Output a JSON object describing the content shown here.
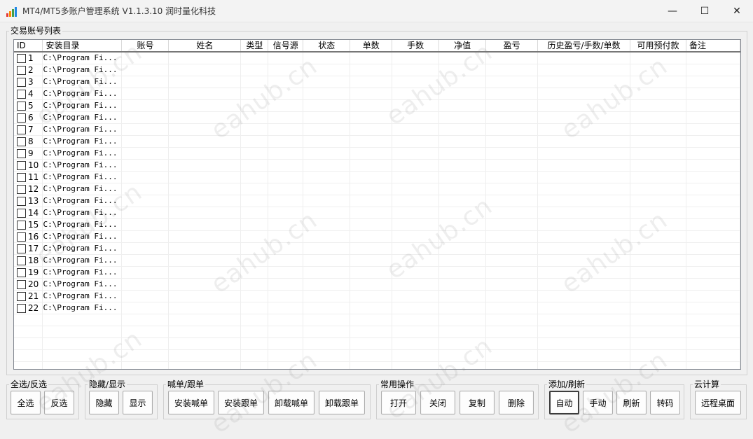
{
  "window": {
    "title": "MT4/MT5多账户管理系统 V1.1.3.10 润时量化科技",
    "minimize_glyph": "—",
    "maximize_glyph": "☐",
    "close_glyph": "✕"
  },
  "accounts_group": {
    "label": "交易账号列表",
    "columns": [
      "ID",
      "安装目录",
      "账号",
      "姓名",
      "类型",
      "信号源",
      "状态",
      "单数",
      "手数",
      "净值",
      "盈亏",
      "历史盈亏/手数/单数",
      "可用预付款",
      "备注"
    ],
    "rows": [
      {
        "id": "1",
        "path": "C:\\Program Fi..."
      },
      {
        "id": "2",
        "path": "C:\\Program Fi..."
      },
      {
        "id": "3",
        "path": "C:\\Program Fi..."
      },
      {
        "id": "4",
        "path": "C:\\Program Fi..."
      },
      {
        "id": "5",
        "path": "C:\\Program Fi..."
      },
      {
        "id": "6",
        "path": "C:\\Program Fi..."
      },
      {
        "id": "7",
        "path": "C:\\Program Fi..."
      },
      {
        "id": "8",
        "path": "C:\\Program Fi..."
      },
      {
        "id": "9",
        "path": "C:\\Program Fi..."
      },
      {
        "id": "10",
        "path": "C:\\Program Fi..."
      },
      {
        "id": "11",
        "path": "C:\\Program Fi..."
      },
      {
        "id": "12",
        "path": "C:\\Program Fi..."
      },
      {
        "id": "13",
        "path": "C:\\Program Fi..."
      },
      {
        "id": "14",
        "path": "C:\\Program Fi..."
      },
      {
        "id": "15",
        "path": "C:\\Program Fi..."
      },
      {
        "id": "16",
        "path": "C:\\Program Fi..."
      },
      {
        "id": "17",
        "path": "C:\\Program Fi..."
      },
      {
        "id": "18",
        "path": "C:\\Program Fi..."
      },
      {
        "id": "19",
        "path": "C:\\Program Fi..."
      },
      {
        "id": "20",
        "path": "C:\\Program Fi..."
      },
      {
        "id": "21",
        "path": "C:\\Program Fi..."
      },
      {
        "id": "22",
        "path": "C:\\Program Fi..."
      }
    ]
  },
  "groups": {
    "select": {
      "label": "全选/反选",
      "buttons": [
        "全选",
        "反选"
      ]
    },
    "hide_show": {
      "label": "隐藏/显示",
      "buttons": [
        "隐藏",
        "显示"
      ]
    },
    "call_follow": {
      "label": "喊单/跟单",
      "buttons": [
        "安装喊单",
        "安装跟单",
        "卸载喊单",
        "卸载跟单"
      ]
    },
    "common_ops": {
      "label": "常用操作",
      "buttons": [
        "打开",
        "关闭",
        "复制",
        "删除"
      ]
    },
    "add_refresh": {
      "label": "添加/刷新",
      "buttons": [
        "自动",
        "手动",
        "刷新",
        "转码"
      ]
    },
    "cloud": {
      "label": "云计算",
      "buttons": [
        "远程桌面"
      ]
    }
  },
  "watermark": "eahub.cn",
  "colors": {
    "icon_bars": [
      "#e53935",
      "#fb8c00",
      "#43a047",
      "#1e88e5"
    ]
  }
}
